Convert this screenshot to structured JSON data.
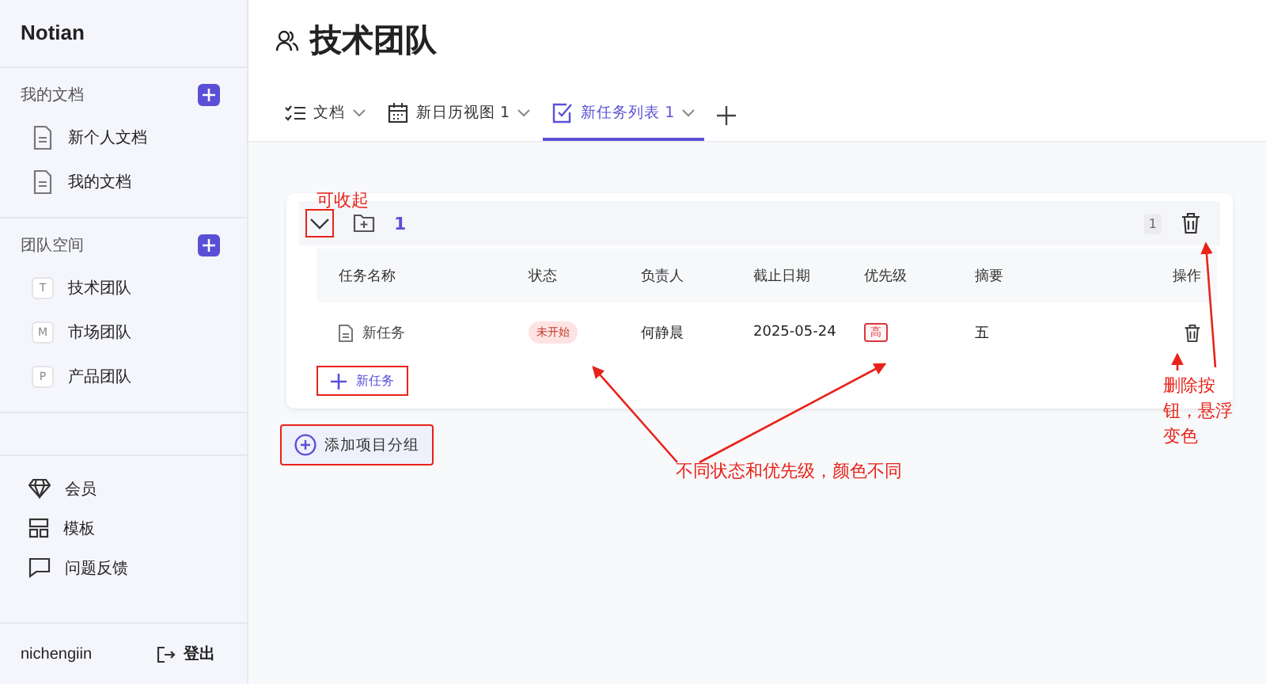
{
  "app_name": "Notian",
  "sidebar": {
    "sections": [
      {
        "title": "我的文档",
        "items": [
          {
            "label": "新个人文档"
          },
          {
            "label": "我的文档"
          }
        ]
      },
      {
        "title": "团队空间",
        "items": [
          {
            "label": "技术团队",
            "initial": "T"
          },
          {
            "label": "市场团队",
            "initial": "M"
          },
          {
            "label": "产品团队",
            "initial": "P"
          }
        ]
      }
    ],
    "links": [
      {
        "label": "会员"
      },
      {
        "label": "模板"
      },
      {
        "label": "问题反馈"
      }
    ],
    "user": "nichengiin",
    "logout": "登出"
  },
  "page": {
    "title": "技术团队"
  },
  "tabs": [
    {
      "label": "文档",
      "selected": false
    },
    {
      "label": "新日历视图 1",
      "selected": false
    },
    {
      "label": "新任务列表 1",
      "selected": true
    }
  ],
  "group": {
    "name": "1",
    "count": "1",
    "expanded": true,
    "highlighted": true,
    "columns": [
      "任务名称",
      "状态",
      "负责人",
      "截止日期",
      "优先级",
      "摘要",
      "操作"
    ],
    "rows": [
      {
        "name": "新任务",
        "status": {
          "text": "未开始",
          "color": "#c0392b"
        },
        "assignee": "何静晨",
        "due": "2025-05-24",
        "priority": {
          "text": "高",
          "color": "#d9363e"
        },
        "summary": "五"
      }
    ],
    "add_task": {
      "label": "新任务",
      "highlighted": true
    }
  },
  "add_group": {
    "label": "添加项目分组",
    "highlighted": true
  },
  "annotations": [
    {
      "text": "可收起"
    },
    {
      "text": "删除按钮，悬浮变色"
    },
    {
      "text": "不同状态和优先级，颜色不同"
    }
  ]
}
